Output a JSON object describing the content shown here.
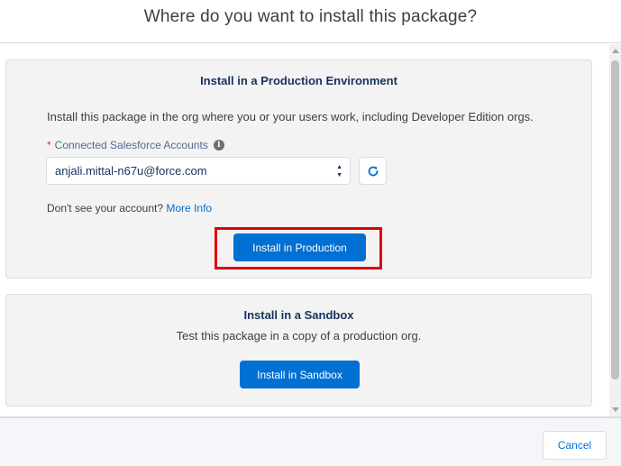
{
  "header": {
    "title": "Where do you want to install this package?"
  },
  "production": {
    "title": "Install in a Production Environment",
    "description": "Install this package in the org where you or your users work, including Developer Edition orgs.",
    "field_label": "Connected Salesforce Accounts",
    "required_marker": "*",
    "info_icon": "i",
    "account_value": "anjali.mittal-n67u@force.com",
    "help_text": "Don't see your account?",
    "help_link": "More Info",
    "button_label": "Install in Production"
  },
  "sandbox": {
    "title": "Install in a Sandbox",
    "description": "Test this package in a copy of a production org.",
    "button_label": "Install in Sandbox"
  },
  "footer": {
    "cancel_label": "Cancel"
  },
  "icons": {
    "refresh": "refresh-icon",
    "info": "info-icon",
    "select_arrows": "chevron-up-down-icon"
  },
  "colors": {
    "brand": "#0070d2",
    "highlight": "#e00000",
    "title": "#16325c",
    "card_bg": "#f3f3f3"
  }
}
